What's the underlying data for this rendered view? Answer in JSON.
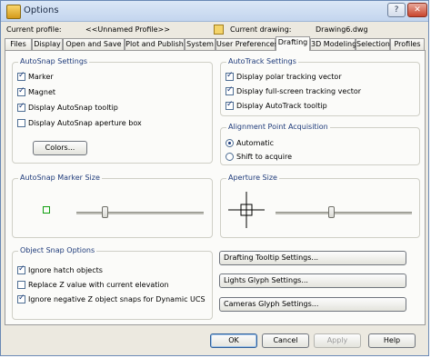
{
  "window": {
    "title": "Options"
  },
  "profile": {
    "current_profile_label": "Current profile:",
    "current_profile_value": "<<Unnamed Profile>>",
    "current_drawing_label": "Current drawing:",
    "current_drawing_value": "Drawing6.dwg"
  },
  "tabs": [
    {
      "label": "Files"
    },
    {
      "label": "Display"
    },
    {
      "label": "Open and Save"
    },
    {
      "label": "Plot and Publish"
    },
    {
      "label": "System"
    },
    {
      "label": "User Preferences"
    },
    {
      "label": "Drafting"
    },
    {
      "label": "3D Modeling"
    },
    {
      "label": "Selection"
    },
    {
      "label": "Profiles"
    }
  ],
  "active_tab": "Drafting",
  "autosnap": {
    "title": "AutoSnap Settings",
    "options": [
      {
        "label": "Marker",
        "checked": true
      },
      {
        "label": "Magnet",
        "checked": true
      },
      {
        "label": "Display AutoSnap tooltip",
        "checked": true
      },
      {
        "label": "Display AutoSnap aperture box",
        "checked": false
      }
    ],
    "colors_button": "Colors..."
  },
  "autotrack": {
    "title": "AutoTrack Settings",
    "options": [
      {
        "label": "Display polar tracking vector",
        "checked": true
      },
      {
        "label": "Display full-screen tracking vector",
        "checked": true
      },
      {
        "label": "Display AutoTrack tooltip",
        "checked": true
      }
    ]
  },
  "alignment": {
    "title": "Alignment Point Acquisition",
    "options": [
      {
        "label": "Automatic",
        "selected": true
      },
      {
        "label": "Shift to acquire",
        "selected": false
      }
    ]
  },
  "marker_size": {
    "title": "AutoSnap Marker Size",
    "marker_color": "#10a010"
  },
  "aperture_size": {
    "title": "Aperture Size"
  },
  "object_snap": {
    "title": "Object Snap Options",
    "options": [
      {
        "label": "Ignore hatch objects",
        "checked": true
      },
      {
        "label": "Replace Z value with current elevation",
        "checked": false
      },
      {
        "label": "Ignore negative Z object snaps for Dynamic UCS",
        "checked": true
      }
    ]
  },
  "right_buttons": {
    "drafting_tooltip": "Drafting Tooltip Settings...",
    "lights_glyph": "Lights Glyph Settings...",
    "cameras_glyph": "Cameras Glyph Settings..."
  },
  "footer": {
    "ok": "OK",
    "cancel": "Cancel",
    "apply": "Apply",
    "help": "Help"
  }
}
